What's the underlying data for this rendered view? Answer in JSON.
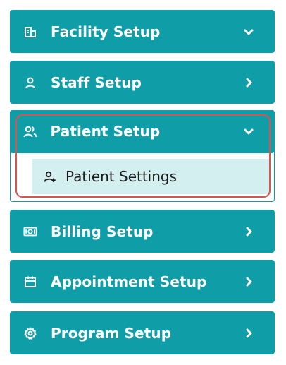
{
  "menu": {
    "facility": {
      "label": "Facility Setup",
      "icon": "building-icon",
      "chevron": "chevron-down"
    },
    "staff": {
      "label": "Staff Setup",
      "icon": "user-icon",
      "chevron": "chevron-right"
    },
    "patient": {
      "label": "Patient Setup",
      "icon": "users-icon",
      "chevron": "chevron-down",
      "expanded": true,
      "children": [
        {
          "label": "Patient Settings",
          "icon": "user-plus-icon",
          "active": true
        }
      ]
    },
    "billing": {
      "label": "Billing Setup",
      "icon": "money-icon",
      "chevron": "chevron-right"
    },
    "appointment": {
      "label": "Appointment Setup",
      "icon": "calendar-icon",
      "chevron": "chevron-right"
    },
    "program": {
      "label": "Program Setup",
      "icon": "gear-icon",
      "chevron": "chevron-right"
    }
  },
  "colors": {
    "accent": "#0f9ea7",
    "active_submenu_bg": "#d3eff0",
    "highlight_border": "#d9534f"
  }
}
